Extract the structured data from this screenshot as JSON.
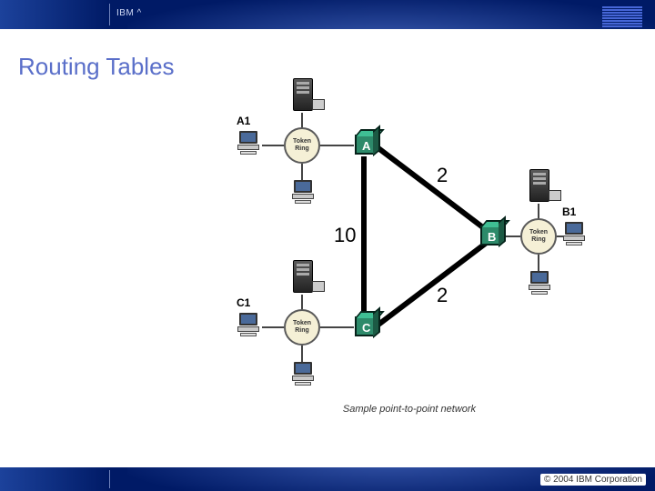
{
  "header": {
    "brand": "IBM ^"
  },
  "title": "Routing Tables",
  "diagram": {
    "caption": "Sample point-to-point network",
    "routers": {
      "A": "A",
      "B": "B",
      "C": "C"
    },
    "hosts": {
      "A1": "A1",
      "B1": "B1",
      "C1": "C1"
    },
    "ring_label": "Token\nRing",
    "link_costs": {
      "AB": "2",
      "BC": "2",
      "AC": "10"
    }
  },
  "footer": {
    "copyright": "© 2004 IBM Corporation"
  }
}
